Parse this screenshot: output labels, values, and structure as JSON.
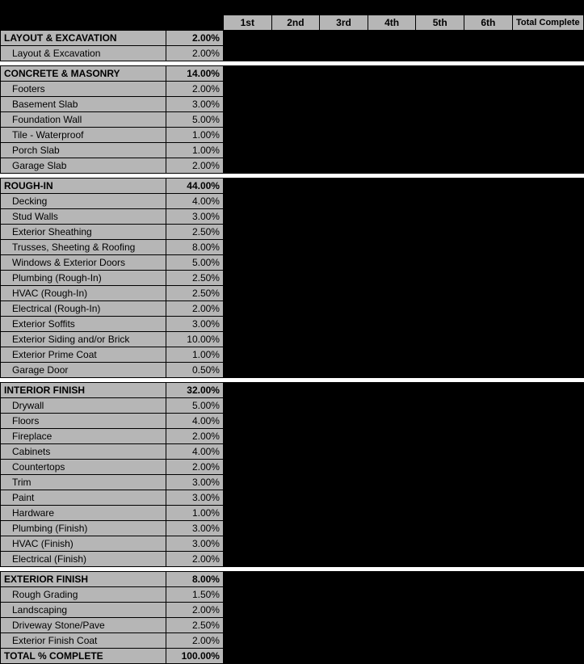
{
  "header": {
    "periods": [
      "1st",
      "2nd",
      "3rd",
      "4th",
      "5th",
      "6th"
    ],
    "total_label": "Total Complete"
  },
  "sections": [
    {
      "name": "LAYOUT & EXCAVATION",
      "pct": "2.00%",
      "items": [
        {
          "name": "Layout & Excavation",
          "pct": "2.00%"
        }
      ]
    },
    {
      "name": "CONCRETE & MASONRY",
      "pct": "14.00%",
      "items": [
        {
          "name": "Footers",
          "pct": "2.00%"
        },
        {
          "name": "Basement Slab",
          "pct": "3.00%"
        },
        {
          "name": "Foundation Wall",
          "pct": "5.00%"
        },
        {
          "name": "Tile - Waterproof",
          "pct": "1.00%"
        },
        {
          "name": "Porch Slab",
          "pct": "1.00%"
        },
        {
          "name": "Garage Slab",
          "pct": "2.00%"
        }
      ]
    },
    {
      "name": "ROUGH-IN",
      "pct": "44.00%",
      "items": [
        {
          "name": "Decking",
          "pct": "4.00%"
        },
        {
          "name": "Stud Walls",
          "pct": "3.00%"
        },
        {
          "name": "Exterior Sheathing",
          "pct": "2.50%"
        },
        {
          "name": "Trusses, Sheeting & Roofing",
          "pct": "8.00%"
        },
        {
          "name": "Windows & Exterior Doors",
          "pct": "5.00%"
        },
        {
          "name": "Plumbing (Rough-In)",
          "pct": "2.50%"
        },
        {
          "name": "HVAC (Rough-In)",
          "pct": "2.50%"
        },
        {
          "name": "Electrical (Rough-In)",
          "pct": "2.00%"
        },
        {
          "name": "Exterior Soffits",
          "pct": "3.00%"
        },
        {
          "name": "Exterior Siding and/or Brick",
          "pct": "10.00%"
        },
        {
          "name": "Exterior Prime Coat",
          "pct": "1.00%"
        },
        {
          "name": "Garage Door",
          "pct": "0.50%"
        }
      ]
    },
    {
      "name": "INTERIOR FINISH",
      "pct": "32.00%",
      "items": [
        {
          "name": "Drywall",
          "pct": "5.00%"
        },
        {
          "name": "Floors",
          "pct": "4.00%"
        },
        {
          "name": "Fireplace",
          "pct": "2.00%"
        },
        {
          "name": "Cabinets",
          "pct": "4.00%"
        },
        {
          "name": "Countertops",
          "pct": "2.00%"
        },
        {
          "name": "Trim",
          "pct": "3.00%"
        },
        {
          "name": "Paint",
          "pct": "3.00%"
        },
        {
          "name": "Hardware",
          "pct": "1.00%"
        },
        {
          "name": "Plumbing (Finish)",
          "pct": "3.00%"
        },
        {
          "name": "HVAC (Finish)",
          "pct": "3.00%"
        },
        {
          "name": "Electrical (Finish)",
          "pct": "2.00%"
        }
      ]
    },
    {
      "name": "EXTERIOR FINISH",
      "pct": "8.00%",
      "items": [
        {
          "name": "Rough Grading",
          "pct": "1.50%"
        },
        {
          "name": "Landscaping",
          "pct": "2.00%"
        },
        {
          "name": "Driveway Stone/Pave",
          "pct": "2.50%"
        },
        {
          "name": "Exterior Finish Coat",
          "pct": "2.00%"
        }
      ]
    }
  ],
  "total": {
    "label": "TOTAL % COMPLETE",
    "pct": "100.00%"
  }
}
